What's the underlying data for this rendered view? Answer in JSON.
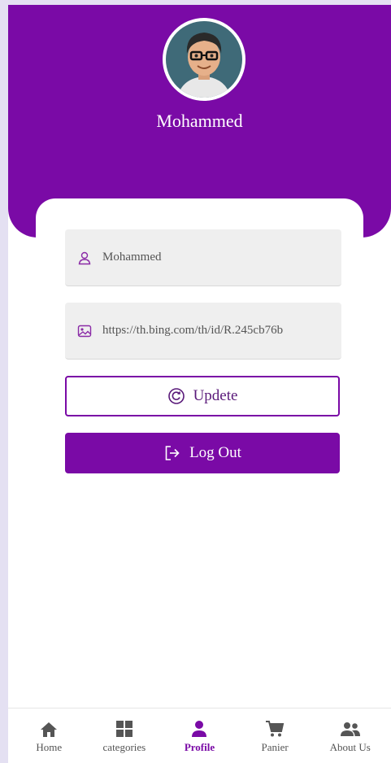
{
  "profile": {
    "name": "Mohammed"
  },
  "form": {
    "name_value": "Mohammed",
    "image_value": "https://th.bing.com/th/id/R.245cb76b"
  },
  "buttons": {
    "update_label": "Updete",
    "logout_label": "Log Out"
  },
  "nav": {
    "items": [
      {
        "label": "Home",
        "icon": "home-icon"
      },
      {
        "label": "categories",
        "icon": "grid-icon"
      },
      {
        "label": "Profile",
        "icon": "person-icon"
      },
      {
        "label": "Panier",
        "icon": "cart-icon"
      },
      {
        "label": "About Us",
        "icon": "people-icon"
      }
    ],
    "active": "Profile"
  },
  "colors": {
    "primary": "#7a0aa6",
    "field_bg": "#efefef",
    "nav_inactive": "#555555"
  }
}
